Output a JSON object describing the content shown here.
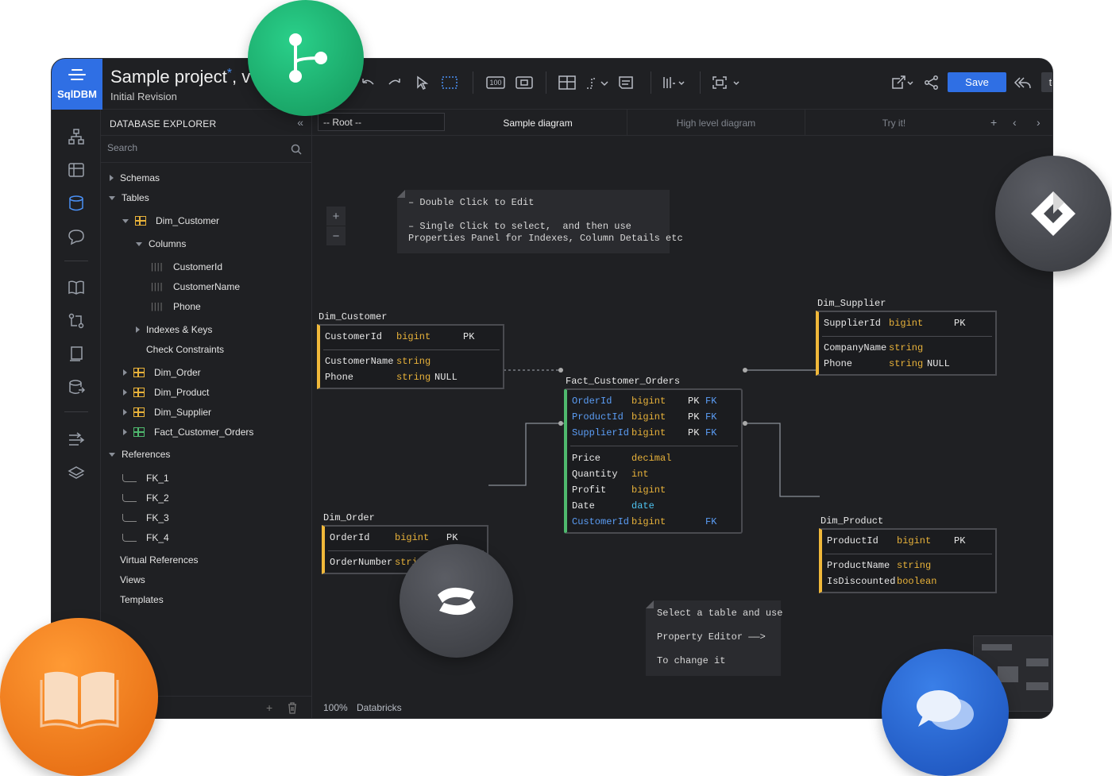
{
  "app": {
    "logo_label": "SqlDBM",
    "project_title": "Sample project",
    "project_title_suffix": ", v",
    "unsaved_marker": "*",
    "revision": "Initial Revision",
    "zoom_badge": "100",
    "save_label": "Save",
    "user_initials": "te"
  },
  "explorer": {
    "title": "DATABASE EXPLORER",
    "collapse_glyph": "«",
    "search_placeholder": "Search",
    "schemas": "Schemas",
    "tables": "Tables",
    "dim_customer": "Dim_Customer",
    "columns": "Columns",
    "col_1": "CustomerId",
    "col_2": "CustomerName",
    "col_3": "Phone",
    "indexes": "Indexes & Keys",
    "constraints": "Check Constraints",
    "dim_order": "Dim_Order",
    "dim_product": "Dim_Product",
    "dim_supplier": "Dim_Supplier",
    "fact": "Fact_Customer_Orders",
    "references": "References",
    "fk_1": "FK_1",
    "fk_2": "FK_2",
    "fk_3": "FK_3",
    "fk_4": "FK_4",
    "virtual_refs": "Virtual References",
    "views": "Views",
    "templates": "Templates"
  },
  "canvas": {
    "root_select": "-- Root --",
    "tab_1": "Sample diagram",
    "tab_2": "High level diagram",
    "tab_3": "Try it!",
    "zoom_in": "+",
    "zoom_out": "−",
    "note_1": "– Double Click to Edit\n\n– Single Click to select,  and then use\nProperties Panel for Indexes, Column Details etc",
    "note_2": "Select a table and use\n\nProperty Editor ——>\n\nTo change it",
    "status_zoom": "100%",
    "status_db": "Databricks"
  },
  "erd": {
    "dim_customer": {
      "name": "Dim_Customer",
      "r1": [
        "CustomerId",
        "bigint",
        "PK"
      ],
      "r2": [
        "CustomerName",
        "string",
        ""
      ],
      "r3": [
        "Phone",
        "string",
        "NULL"
      ]
    },
    "dim_supplier": {
      "name": "Dim_Supplier",
      "r1": [
        "SupplierId",
        "bigint",
        "PK"
      ],
      "r2": [
        "CompanyName",
        "string",
        ""
      ],
      "r3": [
        "Phone",
        "string",
        "NULL"
      ]
    },
    "fact": {
      "name": "Fact_Customer_Orders",
      "r1": [
        "OrderId",
        "bigint",
        "PK",
        "FK"
      ],
      "r2": [
        "ProductId",
        "bigint",
        "PK",
        "FK"
      ],
      "r3": [
        "SupplierId",
        "bigint",
        "PK",
        "FK"
      ],
      "r4": [
        "Price",
        "decimal"
      ],
      "r5": [
        "Quantity",
        "int"
      ],
      "r6": [
        "Profit",
        "bigint"
      ],
      "r7": [
        "Date",
        "date"
      ],
      "r8": [
        "CustomerId",
        "bigint",
        "FK"
      ]
    },
    "dim_order": {
      "name": "Dim_Order",
      "r1": [
        "OrderId",
        "bigint",
        "PK"
      ],
      "r2": [
        "OrderNumber",
        "string"
      ]
    },
    "dim_product": {
      "name": "Dim_Product",
      "r1": [
        "ProductId",
        "bigint",
        "PK"
      ],
      "r2": [
        "ProductName",
        "string"
      ],
      "r3": [
        "IsDiscounted",
        "boolean"
      ]
    }
  },
  "colors": {
    "accent_blue": "#2f6fe4",
    "pk_table_border": "#f0b83a",
    "fact_table_border": "#4fb96e",
    "type_color": "#e8b23a",
    "fk_color": "#5b9df5",
    "integration_git": "#1aa866",
    "integration_jira": "#4a4c52",
    "integration_confluence": "#4a4c52",
    "integration_docs": "#f07b1a",
    "integration_chat": "#1f5fd6"
  },
  "integrations": [
    "git-branch-icon",
    "jira-icon",
    "confluence-icon",
    "book-icon",
    "chat-bubbles-icon"
  ]
}
